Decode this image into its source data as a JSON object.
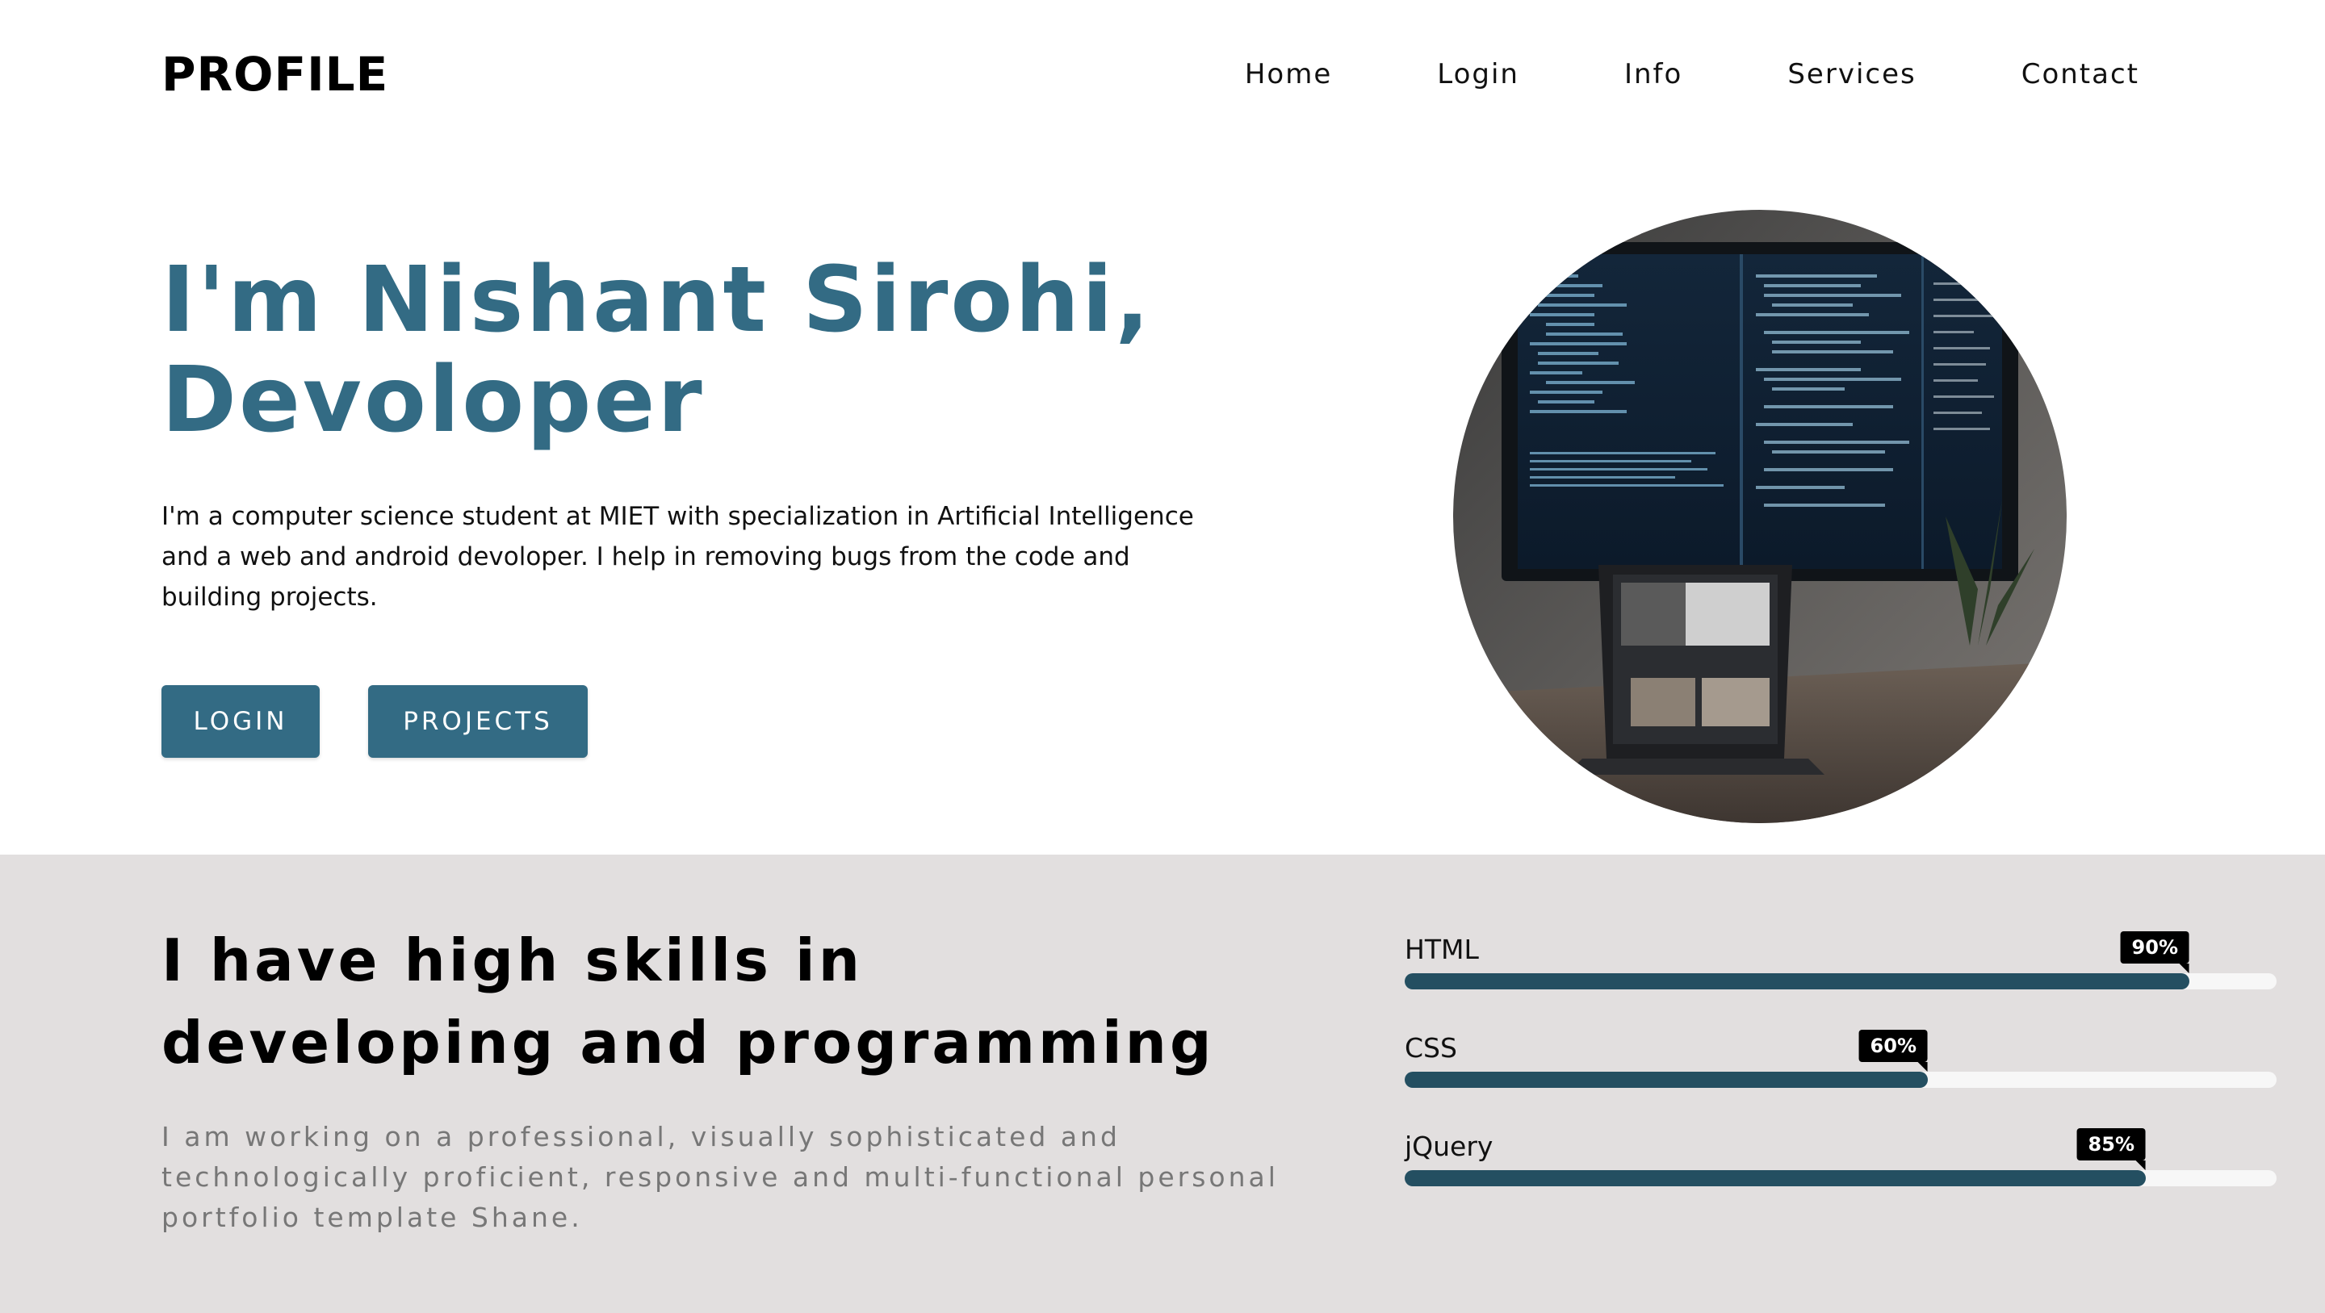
{
  "header": {
    "logo": "PROFILE",
    "nav": [
      "Home",
      "Login",
      "Info",
      "Services",
      "Contact"
    ]
  },
  "hero": {
    "title_line1": "I'm Nishant Sirohi,",
    "title_line2": "Devoloper",
    "description": "I'm a computer science student at MIET with specialization in Artificial Intelligence and a web and android devoloper. I help in removing bugs from the code and building projects.",
    "buttons": {
      "login": "LOGIN",
      "projects": "PROJECTS"
    }
  },
  "skills": {
    "title": "I have high skills in developing and programming",
    "description": "I am working on a professional, visually sophisticated and technologically proficient, responsive and multi-functional personal portfolio template Shane.",
    "items": [
      {
        "name": "HTML",
        "percent_label": "90%",
        "percent": 90
      },
      {
        "name": "CSS",
        "percent_label": "60%",
        "percent": 60
      },
      {
        "name": "jQuery",
        "percent_label": "85%",
        "percent": 85
      }
    ]
  },
  "colors": {
    "accent": "#336b84",
    "bar_fill": "#244f61",
    "skills_bg": "#e2dfdf"
  }
}
